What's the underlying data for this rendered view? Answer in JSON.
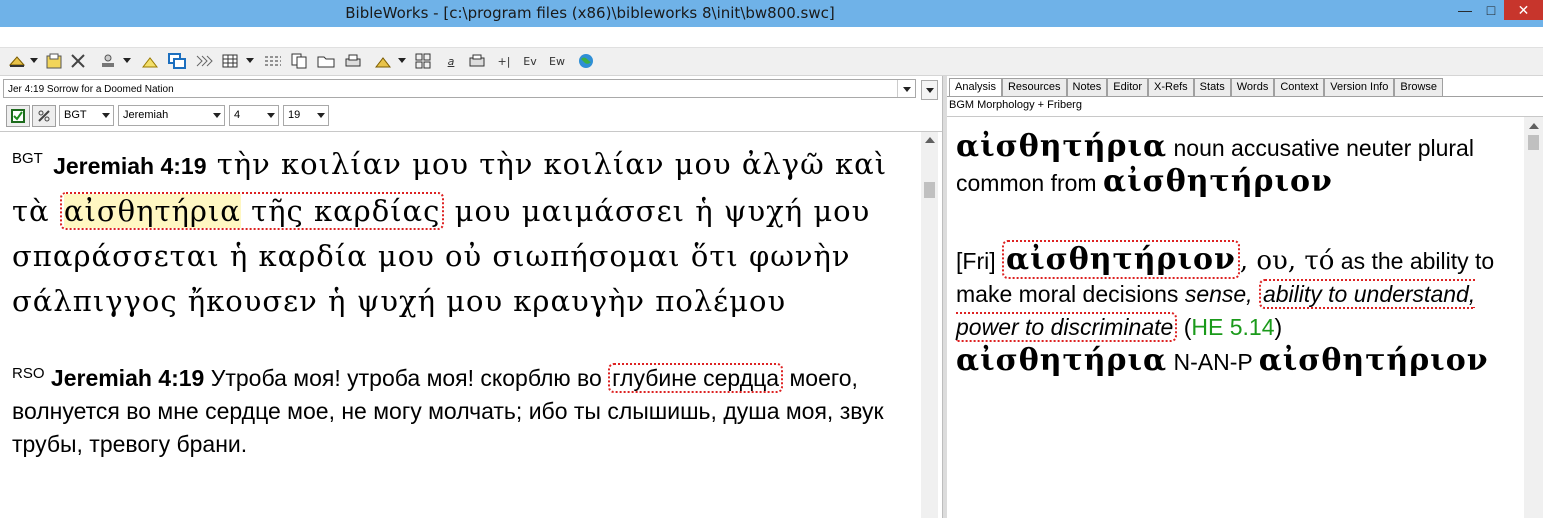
{
  "window": {
    "title": "BibleWorks - [c:\\program files (x86)\\bibleworks 8\\init\\bw800.swc]",
    "controls": {
      "minimize": "—",
      "maximize": "□",
      "close": "✕"
    }
  },
  "toolbar": {
    "buttons": [
      {
        "name": "search-icon"
      },
      {
        "name": "save-icon"
      },
      {
        "name": "tools-icon"
      },
      {
        "name": "stamp-icon"
      },
      {
        "name": "highlight-icon"
      },
      {
        "name": "windows-icon"
      },
      {
        "name": "parallel-icon"
      },
      {
        "name": "grid-icon"
      },
      {
        "name": "columns-icon"
      },
      {
        "name": "copy-icon"
      },
      {
        "name": "folder-icon"
      },
      {
        "name": "print-icon"
      },
      {
        "name": "stamp2-icon"
      },
      {
        "name": "layout-icon"
      },
      {
        "name": "lexicon-icon"
      },
      {
        "name": "add-icon"
      },
      {
        "name": "ev-icon"
      },
      {
        "name": "ew-icon"
      },
      {
        "name": "globe-icon"
      }
    ],
    "labels": {
      "plus": "+|",
      "ev": "Ev",
      "ew": "Ew",
      "a": "a"
    }
  },
  "left_pane": {
    "verse_selector": "Jer 4:19 Sorrow for a Doomed Nation",
    "version": "BGT",
    "book": "Jeremiah",
    "chapter": "4",
    "verse": "19",
    "bgt": {
      "version_tag": "BGT",
      "reference": "Jeremiah 4:19",
      "text_before": " τὴν κοιλίαν μου τὴν κοιλίαν μου ἀλγῶ καὶ τὰ ",
      "highlighted_word": "αἰσθητήρια",
      "text_boxed_rest": " τῆς καρδίας",
      "text_after": " μου μαιμάσσει ἡ ψυχή μου σπαράσσεται ἡ καρδία μου οὐ σιωπήσομαι ὅτι φωνὴν σάλπιγγος ἤκουσεν ἡ ψυχή μου κραυγὴν πολέμου"
    },
    "rso": {
      "version_tag": "RSO",
      "reference": "Jeremiah 4:19",
      "text_before": " Утроба моя! утроба моя! скорблю во ",
      "boxed": "глубине сердца",
      "text_after": " моего, волнуется во мне сердце мое, не могу молчать; ибо ты слышишь, душа моя, звук трубы, тревогу брани."
    }
  },
  "right_pane": {
    "tabs": [
      "Analysis",
      "Resources",
      "Notes",
      "Editor",
      "X-Refs",
      "Stats",
      "Words",
      "Context",
      "Version Info",
      "Browse"
    ],
    "active_tab": "Analysis",
    "subtitle": "BGM Morphology + Friberg",
    "parse": {
      "word": "αἰσθητήρια",
      "description": " noun accusative neuter plural common from ",
      "lemma": "αἰσθητήριον"
    },
    "friberg": {
      "tag": "[Fri]",
      "lemma": "αἰσθητήριον",
      "forms": ", ου, τό",
      "text1": " as the ability to make moral decisions ",
      "italic1": "sense, ",
      "boxed_italic": "ability to understand, power to discriminate",
      "paren_open": " (",
      "ref": "HE 5.14",
      "paren_close": ")"
    },
    "morph": {
      "word": "αἰσθητήρια",
      "code": " N-AN-P ",
      "lemma": "αἰσθητήριον"
    }
  }
}
